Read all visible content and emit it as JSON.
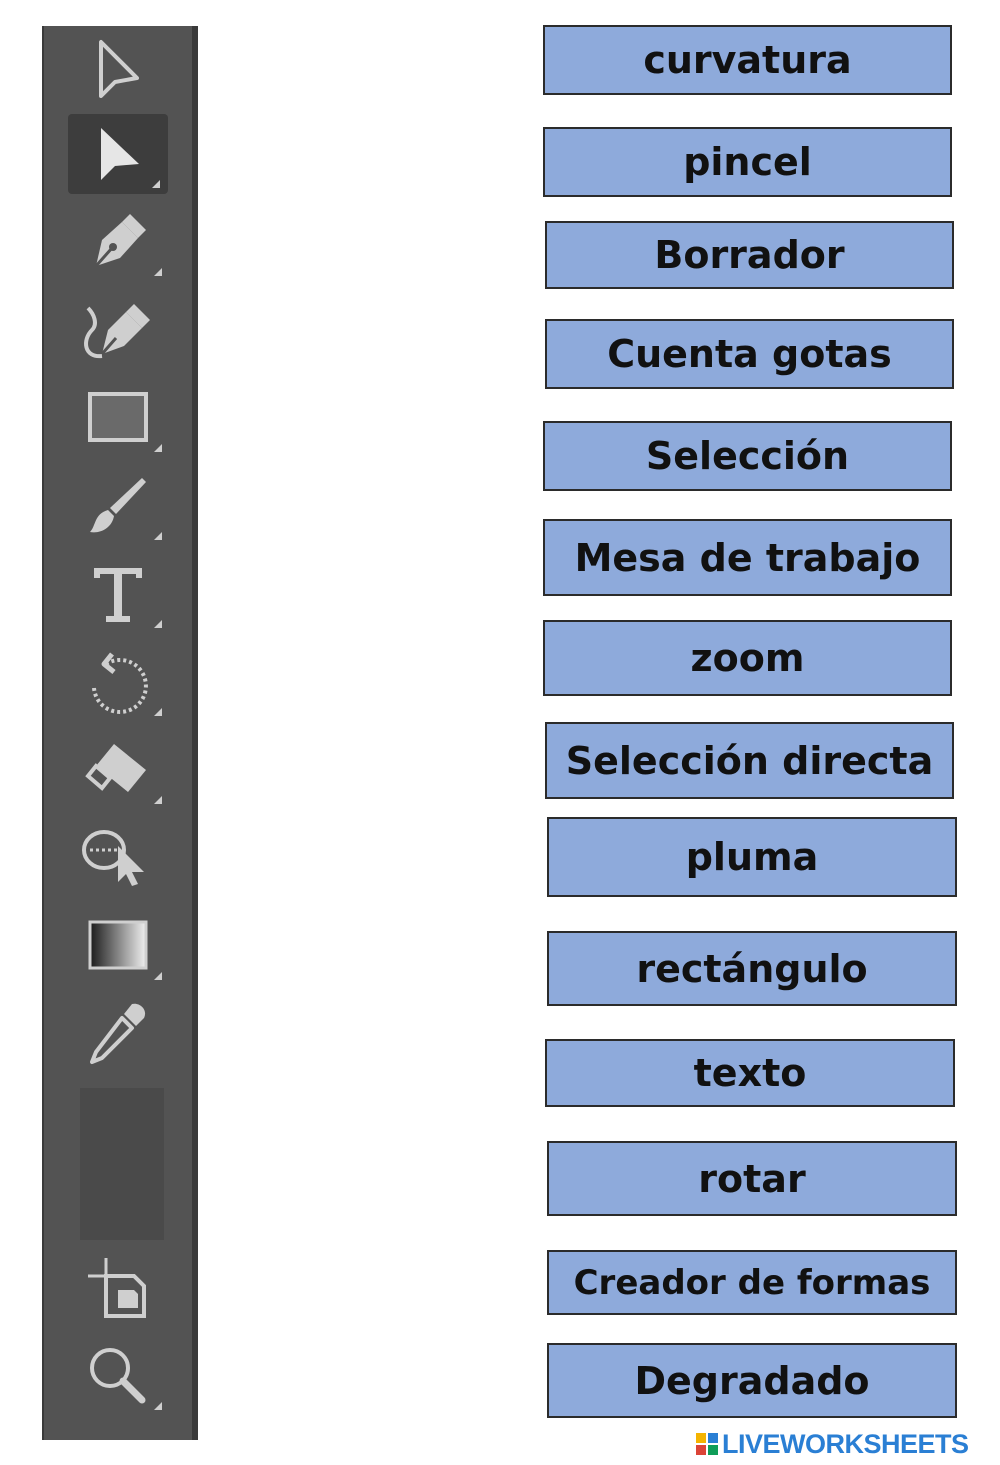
{
  "toolbar": {
    "tools": [
      {
        "icon": "selection-arrow-outline-icon"
      },
      {
        "icon": "direct-selection-arrow-icon",
        "active": true
      },
      {
        "icon": "pen-icon"
      },
      {
        "icon": "curvature-pen-icon"
      },
      {
        "icon": "rectangle-icon"
      },
      {
        "icon": "paintbrush-icon"
      },
      {
        "icon": "type-icon"
      },
      {
        "icon": "rotate-icon"
      },
      {
        "icon": "eraser-icon"
      },
      {
        "icon": "shape-builder-icon"
      },
      {
        "icon": "gradient-icon"
      },
      {
        "icon": "eyedropper-icon"
      },
      {
        "icon": "artboard-icon"
      },
      {
        "icon": "zoom-icon"
      }
    ],
    "colors": {
      "panel": "#535353",
      "icon": "#cfcfcf",
      "active_bg": "#3d3d3d"
    }
  },
  "words": [
    "curvatura",
    "pincel",
    "Borrador",
    "Cuenta gotas",
    "Selección",
    "Mesa de trabajo",
    "zoom",
    "Selección directa",
    "pluma",
    "rectángulo",
    "texto",
    "rotar",
    "Creador de formas",
    "Degradado"
  ],
  "word_colors": {
    "fill": "#8eaadb",
    "border": "#2b2b2b",
    "text": "#111111"
  },
  "brand": {
    "logo_text": "LIVEWORKSHEETS",
    "color": "#2a7fd4"
  }
}
